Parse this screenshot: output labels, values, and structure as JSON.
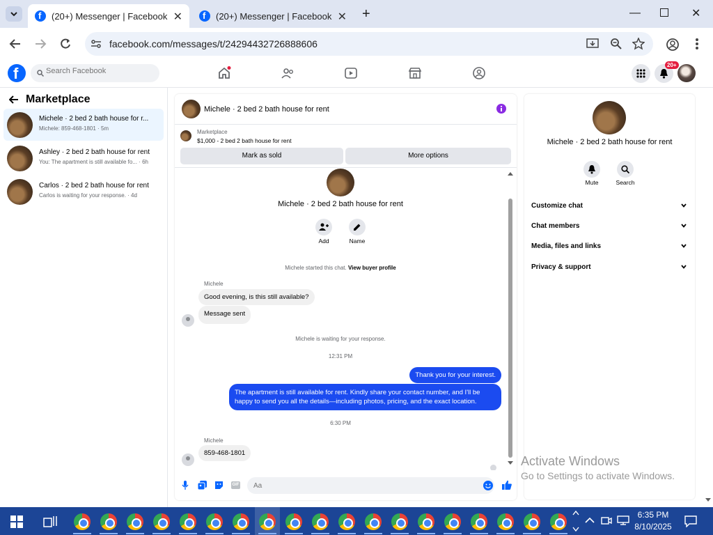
{
  "browser": {
    "tabs": [
      {
        "title": "(20+) Messenger | Facebook",
        "active": true
      },
      {
        "title": "(20+) Messenger | Facebook",
        "active": false
      }
    ],
    "url": "facebook.com/messages/t/24294432726888606"
  },
  "fb": {
    "search_placeholder": "Search Facebook",
    "notif_badge": "20+"
  },
  "left": {
    "title": "Marketplace",
    "conversations": [
      {
        "title": "Michele · 2 bed 2 bath house for r...",
        "snippet": "Michele: 859-468-1801 · 5m",
        "selected": true
      },
      {
        "title": "Ashley · 2 bed 2 bath house for rent",
        "snippet": "You: The apartment is still available fo... · 6h",
        "selected": false
      },
      {
        "title": "Carlos · 2 bed 2 bath house for rent",
        "snippet": "Carlos is waiting for your response. · 4d",
        "selected": false
      }
    ]
  },
  "chat": {
    "header_title": "Michele · 2 bed 2 bath house for rent",
    "marketplace_label": "Marketplace",
    "listing": "$1,000 - 2 bed 2 bath house for rent",
    "mark_sold": "Mark as sold",
    "more_options": "More options",
    "intro_name": "Michele · 2 bed 2 bath house for rent",
    "add_label": "Add",
    "name_label": "Name",
    "started_text": "Michele started this chat.",
    "view_buyer": "View buyer profile",
    "sender1": "Michele",
    "msg1": "Good evening, is this still available?",
    "msg2": "Message sent",
    "waiting": "Michele is waiting for your response.",
    "time1": "12:31 PM",
    "out1": "Thank you for your interest.",
    "out2": "The apartment is still available for rent. Kindly share your contact number, and I'll be happy to send you all the details—including photos, pricing, and the exact location.",
    "time2": "6:30 PM",
    "sender2": "Michele",
    "msg3": "859-468-1801",
    "composer_placeholder": "Aa"
  },
  "right": {
    "name": "Michele · 2 bed 2 bath house for rent",
    "mute": "Mute",
    "search": "Search",
    "sections": [
      "Customize chat",
      "Chat members",
      "Media, files and links",
      "Privacy & support"
    ]
  },
  "watermark": {
    "line1": "Activate Windows",
    "line2": "Go to Settings to activate Windows."
  },
  "taskbar": {
    "time": "6:35 PM",
    "date": "8/10/2025"
  },
  "colors": {
    "fb_blue": "#0866ff",
    "outgoing_bubble": "#1b4bf0",
    "taskbar": "#1c4596"
  }
}
